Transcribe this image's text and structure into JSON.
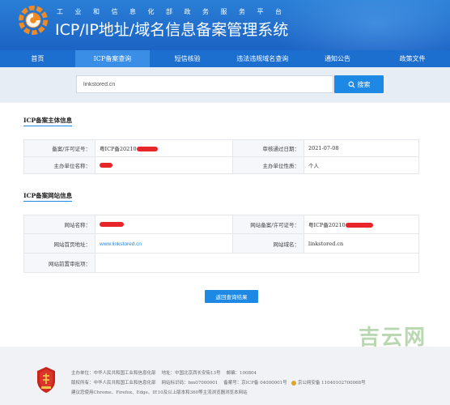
{
  "header": {
    "org_name": "工业和信息化部政务服务平台",
    "site_title": "ICP/IP地址/域名信息备案管理系统"
  },
  "nav": {
    "items": [
      "首页",
      "ICP备案查询",
      "短信核验",
      "违法违规域名查询",
      "通知公告",
      "政策文件"
    ],
    "active_index": 1
  },
  "search": {
    "value": "linkstored.cn",
    "button_label": "搜索"
  },
  "icp_subject": {
    "title": "ICP备案主体信息",
    "license_label": "备案/许可证号：",
    "license_value": "粤ICP备20210",
    "audit_date_label": "审核通过日期：",
    "audit_date_value": "2021-07-08",
    "org_name_label": "主办单位名称：",
    "org_nature_label": "主办单位性质：",
    "org_nature_value": "个人"
  },
  "icp_site": {
    "title": "ICP备案网站信息",
    "site_name_label": "网站名称：",
    "site_license_label": "网站备案/许可证号：",
    "site_license_value": "粤ICP备20210",
    "homepage_label": "网站首页地址：",
    "homepage_value": "www.linkstored.cn",
    "domain_label": "网站域名：",
    "domain_value": "linkstored.cn",
    "preapproval_label": "网站前置审批项："
  },
  "back_button_label": "返回查询结果",
  "watermark": "吉云网",
  "footer": {
    "host": "主办单位：中华人民共和国工业和信息化部",
    "address": "地址：中国北京西长安街13号",
    "postcode": "邮编：100804",
    "copyright": "版权所有：中华人民共和国工业和信息化部",
    "site_id": "网站标识码：bm07000001",
    "icp_no": "备案号：京ICP备 04000001号",
    "police_no": "京公网安备 11040102700068号",
    "browser_tip": "建议您使用Chrome、Firefox、Edge、IE10及以上版本和360等主流浏览器浏览本网站"
  },
  "colors": {
    "header_blue": "#1c63c4",
    "nav_blue": "#1d6fcf",
    "accent": "#1e88e5",
    "redaction": "#e8262a"
  }
}
